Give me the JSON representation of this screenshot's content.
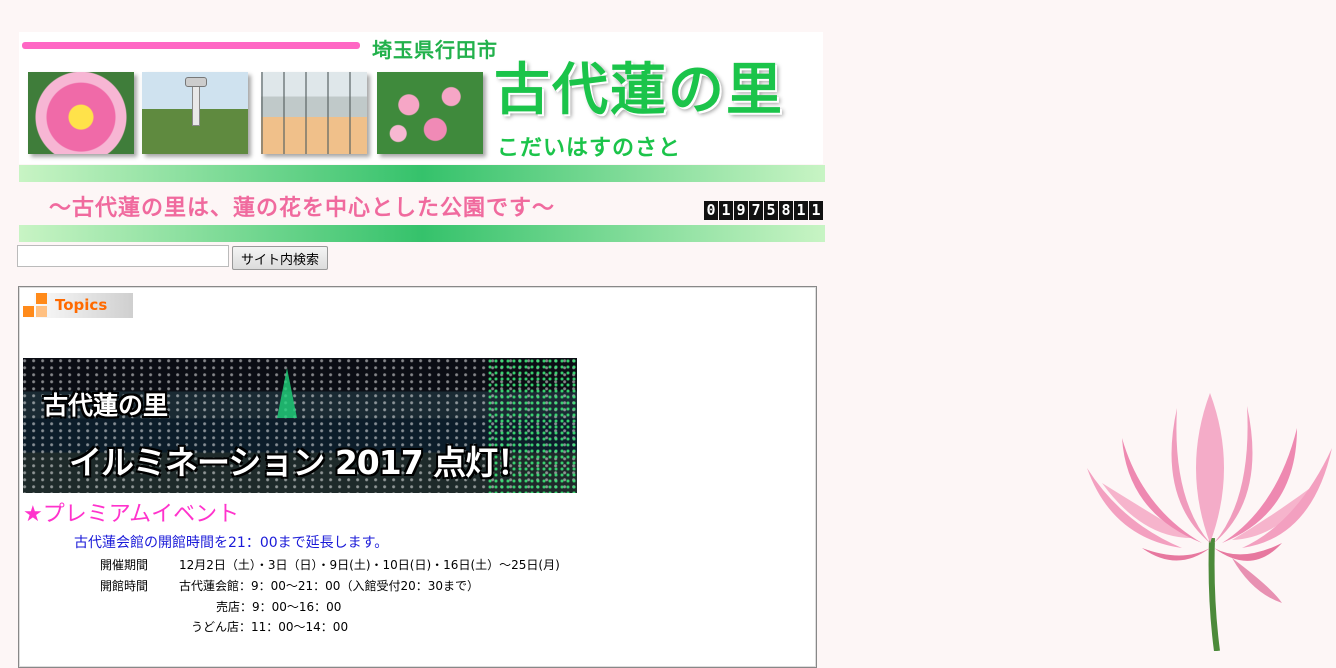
{
  "header": {
    "prefecture": "埼玉県行田市",
    "title": "古代蓮の里",
    "subtitle": "こだいはすのさと",
    "tagline": "～古代蓮の里は、蓮の花を中心とした公園です～",
    "counter_digits": [
      "0",
      "1",
      "9",
      "7",
      "5",
      "8",
      "1",
      "1"
    ],
    "accent_pink": "#ff66c4",
    "accent_green": "#1bc44a"
  },
  "search": {
    "input_value": "",
    "button_label": "サイト内検索"
  },
  "topics": {
    "tab_label": "Topics",
    "banner_line1": "古代蓮の里",
    "banner_line2": "イルミネーション 2017 点灯！",
    "premium_heading": "★プレミアムイベント",
    "extension_notice": "古代蓮会館の開館時間を21：00まで延長します。",
    "period_label": "開催期間",
    "period_value": "12月2日（土）・3日（日）・9日(土)・10日(日)・16日(土）～25日(月)",
    "hours_label": "開館時間",
    "hours_hall": "古代蓮会館：9：00～21：00（入館受付20：30まで）",
    "hours_shop": "売店：9：00～16：00",
    "hours_udon": "うどん店：11：00～14：00"
  }
}
